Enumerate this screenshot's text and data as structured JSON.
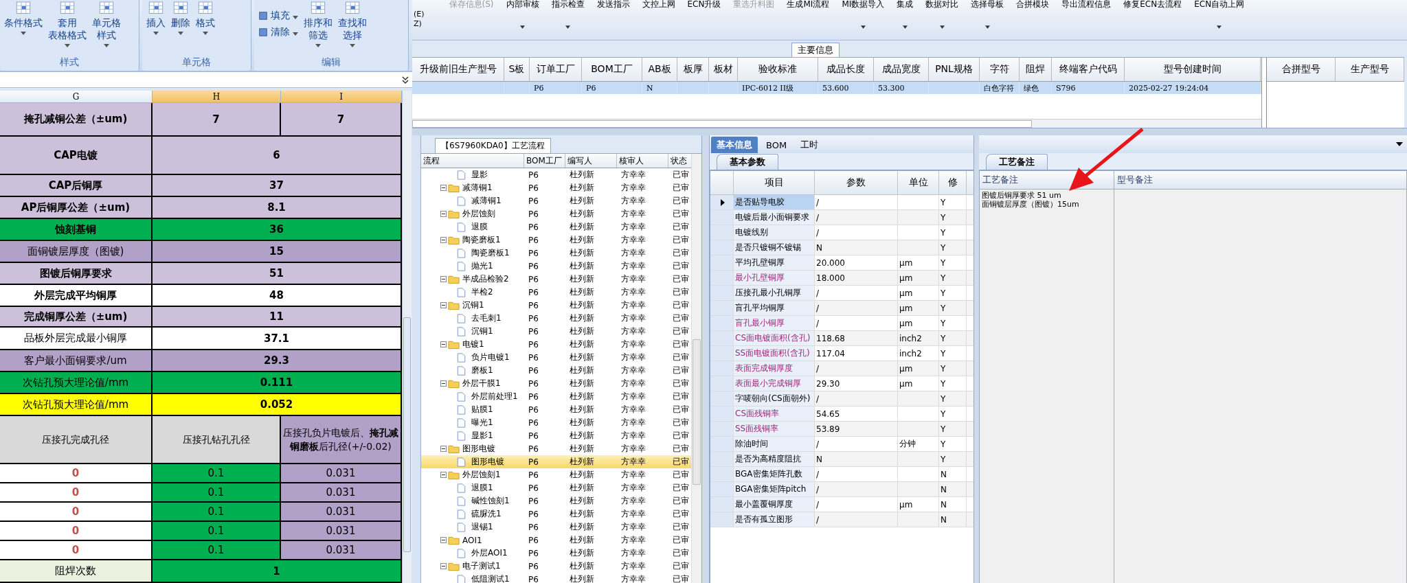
{
  "sheet": {
    "ribbon": [
      {
        "label": "样式",
        "buttons": [
          {
            "lines": [
              "条件格式"
            ],
            "dropdown": true
          },
          {
            "lines": [
              "套用",
              "表格格式"
            ],
            "dropdown": true
          },
          {
            "lines": [
              "单元格",
              "样式"
            ],
            "dropdown": true
          }
        ]
      },
      {
        "label": "单元格",
        "buttons": [
          {
            "lines": [
              "插入"
            ],
            "dropdown": true
          },
          {
            "lines": [
              "删除"
            ],
            "dropdown": true
          },
          {
            "lines": [
              "格式"
            ],
            "dropdown": true
          }
        ]
      },
      {
        "label": "编辑",
        "buttons": [
          {
            "lines": [
              "排序和",
              "筛选"
            ],
            "dropdown": true
          },
          {
            "lines": [
              "查找和",
              "选择"
            ],
            "dropdown": true
          }
        ],
        "small": [
          {
            "label": "填充",
            "dropdown": true
          },
          {
            "label": "清除",
            "dropdown": true
          }
        ]
      }
    ],
    "columns": [
      {
        "label": "G",
        "selected": false
      },
      {
        "label": "H",
        "selected": true
      },
      {
        "label": "I",
        "selected": true
      }
    ],
    "rows": [
      {
        "kind": "split",
        "cells": [
          {
            "text": "掩孔减铜公差（±um)",
            "color": "#ccc0da",
            "bold": true
          },
          {
            "text": "7",
            "color": "#ccc0da",
            "bold": true
          },
          {
            "text": "7",
            "color": "#ccc0da",
            "bold": true
          }
        ]
      },
      {
        "kind": "pair",
        "cells": [
          {
            "text": "CAP电镀",
            "color": "#ccc0da",
            "bold": true
          },
          {
            "text": "6",
            "color": "#ccc0da",
            "bold": true
          }
        ]
      },
      {
        "kind": "pair",
        "cells": [
          {
            "text": "CAP后铜厚",
            "color": "#ccc0da",
            "bold": true
          },
          {
            "text": "37",
            "color": "#ccc0da",
            "bold": true
          }
        ]
      },
      {
        "kind": "pair",
        "cells": [
          {
            "text": "AP后铜厚公差（±um)",
            "color": "#ccc0da",
            "bold": true
          },
          {
            "text": "8.1",
            "color": "#ccc0da",
            "bold": true
          }
        ]
      },
      {
        "kind": "pair",
        "cells": [
          {
            "text": "蚀刻基铜",
            "color": "#00b050",
            "bold": true
          },
          {
            "text": "36",
            "color": "#00b050",
            "bold": true
          }
        ]
      },
      {
        "kind": "pair",
        "cells": [
          {
            "text": "面铜镀层厚度（图镀)",
            "color": "#b1a0c7",
            "bold": false
          },
          {
            "text": "15",
            "color": "#b1a0c7",
            "bold": true
          }
        ]
      },
      {
        "kind": "pair",
        "cells": [
          {
            "text": "图镀后铜厚要求",
            "color": "#ccc0da",
            "bold": true
          },
          {
            "text": "51",
            "color": "#ccc0da",
            "bold": true
          }
        ]
      },
      {
        "kind": "pair",
        "cells": [
          {
            "text": "外层完成平均铜厚",
            "color": "#ffffff",
            "bold": true
          },
          {
            "text": "48",
            "color": "#ffffff",
            "bold": true
          }
        ]
      },
      {
        "kind": "pair",
        "cells": [
          {
            "text": "完成铜厚公差（±um)",
            "color": "#ccc0da",
            "bold": true
          },
          {
            "text": "11",
            "color": "#ccc0da",
            "bold": true
          }
        ]
      },
      {
        "kind": "pair",
        "cells": [
          {
            "text": "品板外层完成最小铜厚",
            "color": "#ffffff",
            "bold": false
          },
          {
            "text": "37.1",
            "color": "#ffffff",
            "bold": true
          }
        ]
      },
      {
        "kind": "pair",
        "cells": [
          {
            "text": "客户最小面铜要求/um",
            "color": "#b1a0c7",
            "bold": false
          },
          {
            "text": "29.3",
            "color": "#b1a0c7",
            "bold": true
          }
        ]
      },
      {
        "kind": "pair",
        "cells": [
          {
            "text": "次钻孔预大理论值/mm",
            "color": "#00b050",
            "bold": false
          },
          {
            "text": "0.111",
            "color": "#00b050",
            "bold": true
          }
        ]
      },
      {
        "kind": "pair",
        "cells": [
          {
            "text": "次钻孔预大理论值/mm",
            "color": "#ffff00",
            "bold": false
          },
          {
            "text": "0.052",
            "color": "#ffff00",
            "bold": true
          }
        ]
      },
      {
        "kind": "triple",
        "cells": [
          {
            "text": "压接孔完成孔径",
            "color": "#d9d9d9",
            "bold": false
          },
          {
            "text": "压接孔钻孔孔径",
            "color": "#d9d9d9",
            "bold": false
          },
          {
            "text": "压接孔负片电镀后、**掩孔减铜磨板**后孔径(+/-0.02)",
            "color": "#b1a0c7",
            "bold": false
          }
        ]
      },
      {
        "kind": "triple",
        "cells": [
          {
            "text": "0",
            "color": "#ffffff",
            "bold": true,
            "warning": true
          },
          {
            "text": "0.1",
            "color": "#00b050",
            "bold": false
          },
          {
            "text": "0.031",
            "color": "#b1a0c7",
            "bold": false
          }
        ]
      },
      {
        "kind": "triple",
        "cells": [
          {
            "text": "0",
            "color": "#ffffff",
            "bold": true,
            "warning": true
          },
          {
            "text": "0.1",
            "color": "#00b050",
            "bold": false
          },
          {
            "text": "0.031",
            "color": "#b1a0c7",
            "bold": false
          }
        ]
      },
      {
        "kind": "triple",
        "cells": [
          {
            "text": "0",
            "color": "#ffffff",
            "bold": true,
            "warning": true
          },
          {
            "text": "0.1",
            "color": "#00b050",
            "bold": false
          },
          {
            "text": "0.031",
            "color": "#b1a0c7",
            "bold": false
          }
        ]
      },
      {
        "kind": "triple",
        "cells": [
          {
            "text": "0",
            "color": "#ffffff",
            "bold": true,
            "warning": true
          },
          {
            "text": "0.1",
            "color": "#00b050",
            "bold": false
          },
          {
            "text": "0.031",
            "color": "#b1a0c7",
            "bold": false
          }
        ]
      },
      {
        "kind": "triple",
        "cells": [
          {
            "text": "0",
            "color": "#ffffff",
            "bold": true,
            "warning": true
          },
          {
            "text": "0.1",
            "color": "#00b050",
            "bold": false
          },
          {
            "text": "0.031",
            "color": "#b1a0c7",
            "bold": false
          }
        ]
      },
      {
        "kind": "pair",
        "cells": [
          {
            "text": "阻焊次数",
            "color": "#ebf1de",
            "bold": false
          },
          {
            "text": "1",
            "color": "#00b050",
            "bold": true
          }
        ]
      }
    ]
  },
  "toolbar": {
    "menu_fragments": [
      "(E)",
      "Z)"
    ],
    "items": [
      {
        "label": "保存信息(S)",
        "disabled": true,
        "dropdown": false
      },
      {
        "label": "内部审核",
        "disabled": false,
        "dropdown": true
      },
      {
        "label": "指示检查",
        "disabled": false,
        "dropdown": true
      },
      {
        "label": "发送指示",
        "disabled": false,
        "dropdown": false
      },
      {
        "label": "文控上网",
        "disabled": false,
        "dropdown": false
      },
      {
        "label": "ECN升级",
        "disabled": false,
        "dropdown": false
      },
      {
        "label": "重选升料图",
        "disabled": true,
        "dropdown": false
      },
      {
        "label": "生成MI流程",
        "disabled": false,
        "dropdown": false
      },
      {
        "label": "MI数据导入",
        "disabled": false,
        "dropdown": true
      },
      {
        "label": "集成",
        "disabled": false,
        "dropdown": true
      },
      {
        "label": "数据对比",
        "disabled": false,
        "dropdown": true
      },
      {
        "label": "选择母板",
        "disabled": false,
        "dropdown": true
      },
      {
        "label": "合拼模块",
        "disabled": false,
        "dropdown": false
      },
      {
        "label": "导出流程信息",
        "disabled": false,
        "dropdown": false
      },
      {
        "label": "修复ECN去流程",
        "disabled": false,
        "dropdown": false
      },
      {
        "label": "ECN自动上网",
        "disabled": false,
        "dropdown": true
      }
    ]
  },
  "main_info": {
    "title": "主要信息",
    "columns": [
      "升级前旧生产型号",
      "S板",
      "订单工厂",
      "BOM工厂",
      "AB板",
      "板厚",
      "板材",
      "验收标准",
      "成品长度",
      "成品宽度",
      "PNL规格",
      "字符",
      "阻焊",
      "终端客户代码",
      "型号创建时间"
    ],
    "rows": [
      {
        "selected": true,
        "cells": [
          "",
          "",
          "P6",
          "P6",
          "N",
          "",
          "",
          "IPC-6012 II级",
          "53.600",
          "53.300",
          "",
          "白色字符",
          "绿色",
          "S796",
          "2025-02-27 19:24:04"
        ]
      }
    ],
    "side_columns": [
      "合拼型号",
      "生产型号"
    ]
  },
  "process": {
    "title": "【6S7960KDA0】工艺流程",
    "columns": [
      "流程",
      "BOM工厂",
      "编写人",
      "核审人",
      "状态"
    ],
    "nodes": [
      {
        "kind": "leaf",
        "label": "显影",
        "bom": "P6",
        "writer": "杜列新",
        "reviewer": "方幸幸",
        "status": "已审",
        "selected": false
      },
      {
        "kind": "folder",
        "label": "减薄铜1",
        "bom": "P6",
        "writer": "杜列新",
        "reviewer": "方幸幸",
        "status": "已审",
        "selected": false,
        "expanded": true,
        "children": [
          {
            "kind": "leaf",
            "label": "减薄铜1",
            "bom": "P6",
            "writer": "杜列新",
            "reviewer": "方幸幸",
            "status": "已审",
            "selected": false
          }
        ]
      },
      {
        "kind": "folder",
        "label": "外层蚀刻",
        "bom": "P6",
        "writer": "杜列新",
        "reviewer": "方幸幸",
        "status": "已审",
        "selected": false,
        "expanded": true,
        "children": [
          {
            "kind": "leaf",
            "label": "退膜",
            "bom": "P6",
            "writer": "杜列新",
            "reviewer": "方幸幸",
            "status": "已审",
            "selected": false
          }
        ]
      },
      {
        "kind": "folder",
        "label": "陶瓷磨板1",
        "bom": "P6",
        "writer": "杜列新",
        "reviewer": "方幸幸",
        "status": "已审",
        "selected": false,
        "expanded": true,
        "children": [
          {
            "kind": "leaf",
            "label": "陶瓷磨板1",
            "bom": "P6",
            "writer": "杜列新",
            "reviewer": "方幸幸",
            "status": "已审",
            "selected": false
          },
          {
            "kind": "leaf",
            "label": "抛光1",
            "bom": "P6",
            "writer": "杜列新",
            "reviewer": "方幸幸",
            "status": "已审",
            "selected": false
          }
        ]
      },
      {
        "kind": "folder",
        "label": "半成品检验2",
        "bom": "P6",
        "writer": "杜列新",
        "reviewer": "方幸幸",
        "status": "已审",
        "selected": false,
        "expanded": true,
        "children": [
          {
            "kind": "leaf",
            "label": "半检2",
            "bom": "P6",
            "writer": "杜列新",
            "reviewer": "方幸幸",
            "status": "已审",
            "selected": false
          }
        ]
      },
      {
        "kind": "folder",
        "label": "沉铜1",
        "bom": "P6",
        "writer": "杜列新",
        "reviewer": "方幸幸",
        "status": "已审",
        "selected": false,
        "expanded": true,
        "children": [
          {
            "kind": "leaf",
            "label": "去毛刺1",
            "bom": "P6",
            "writer": "杜列新",
            "reviewer": "方幸幸",
            "status": "已审",
            "selected": false
          },
          {
            "kind": "leaf",
            "label": "沉铜1",
            "bom": "P6",
            "writer": "杜列新",
            "reviewer": "方幸幸",
            "status": "已审",
            "selected": false
          }
        ]
      },
      {
        "kind": "folder",
        "label": "电镀1",
        "bom": "P6",
        "writer": "杜列新",
        "reviewer": "方幸幸",
        "status": "已审",
        "selected": false,
        "expanded": true,
        "children": [
          {
            "kind": "leaf",
            "label": "负片电镀1",
            "bom": "P6",
            "writer": "杜列新",
            "reviewer": "方幸幸",
            "status": "已审",
            "selected": false
          },
          {
            "kind": "leaf",
            "label": "磨板1",
            "bom": "P6",
            "writer": "杜列新",
            "reviewer": "方幸幸",
            "status": "已审",
            "selected": false
          }
        ]
      },
      {
        "kind": "folder",
        "label": "外层干膜1",
        "bom": "P6",
        "writer": "杜列新",
        "reviewer": "方幸幸",
        "status": "已审",
        "selected": false,
        "expanded": true,
        "children": [
          {
            "kind": "leaf",
            "label": "外层前处理1",
            "bom": "P6",
            "writer": "杜列新",
            "reviewer": "方幸幸",
            "status": "已审",
            "selected": false
          },
          {
            "kind": "leaf",
            "label": "贴膜1",
            "bom": "P6",
            "writer": "杜列新",
            "reviewer": "方幸幸",
            "status": "已审",
            "selected": false
          },
          {
            "kind": "leaf",
            "label": "曝光1",
            "bom": "P6",
            "writer": "杜列新",
            "reviewer": "方幸幸",
            "status": "已审",
            "selected": false
          },
          {
            "kind": "leaf",
            "label": "显影1",
            "bom": "P6",
            "writer": "杜列新",
            "reviewer": "方幸幸",
            "status": "已审",
            "selected": false
          }
        ]
      },
      {
        "kind": "folder",
        "label": "图形电镀",
        "bom": "P6",
        "writer": "杜列新",
        "reviewer": "方幸幸",
        "status": "已审",
        "selected": false,
        "expanded": true,
        "children": [
          {
            "kind": "leaf",
            "label": "图形电镀",
            "bom": "P6",
            "writer": "杜列新",
            "reviewer": "方幸幸",
            "status": "已审",
            "selected": true
          }
        ]
      },
      {
        "kind": "folder",
        "label": "外层蚀刻1",
        "bom": "P6",
        "writer": "杜列新",
        "reviewer": "方幸幸",
        "status": "已审",
        "selected": false,
        "expanded": true,
        "children": [
          {
            "kind": "leaf",
            "label": "退膜1",
            "bom": "P6",
            "writer": "杜列新",
            "reviewer": "方幸幸",
            "status": "已审",
            "selected": false
          },
          {
            "kind": "leaf",
            "label": "碱性蚀刻1",
            "bom": "P6",
            "writer": "杜列新",
            "reviewer": "方幸幸",
            "status": "已审",
            "selected": false
          },
          {
            "kind": "leaf",
            "label": "硫脲洗1",
            "bom": "P6",
            "writer": "杜列新",
            "reviewer": "方幸幸",
            "status": "已审",
            "selected": false
          },
          {
            "kind": "leaf",
            "label": "退锡1",
            "bom": "P6",
            "writer": "杜列新",
            "reviewer": "方幸幸",
            "status": "已审",
            "selected": false
          }
        ]
      },
      {
        "kind": "folder",
        "label": "AOI1",
        "bom": "P6",
        "writer": "杜列新",
        "reviewer": "方幸幸",
        "status": "已审",
        "selected": false,
        "expanded": true,
        "children": [
          {
            "kind": "leaf",
            "label": "外层AOI1",
            "bom": "P6",
            "writer": "杜列新",
            "reviewer": "方幸幸",
            "status": "已审",
            "selected": false
          }
        ]
      },
      {
        "kind": "folder",
        "label": "电子测试1",
        "bom": "P6",
        "writer": "杜列新",
        "reviewer": "方幸幸",
        "status": "已审",
        "selected": false,
        "expanded": true,
        "children": [
          {
            "kind": "leaf",
            "label": "低阻测试1",
            "bom": "P6",
            "writer": "杜列新",
            "reviewer": "方幸幸",
            "status": "已审",
            "selected": false
          }
        ]
      }
    ]
  },
  "basic": {
    "tabs": [
      {
        "label": "基本信息",
        "selected": true
      },
      {
        "label": "BOM",
        "selected": false
      },
      {
        "label": "工时",
        "selected": false
      }
    ],
    "subtab": "基本参数",
    "columns": [
      "项目",
      "参数",
      "单位",
      "修"
    ],
    "rows": [
      {
        "item": "是否贴导电胶",
        "param": "/",
        "unit": "",
        "modified": "Y",
        "flagged": false,
        "current": true
      },
      {
        "item": "电镀后最小面铜要求",
        "param": "/",
        "unit": "",
        "modified": "Y",
        "flagged": false,
        "current": false
      },
      {
        "item": "电镀线别",
        "param": "/",
        "unit": "",
        "modified": "Y",
        "flagged": false,
        "current": false
      },
      {
        "item": "是否只镀铜不镀锡",
        "param": "N",
        "unit": "",
        "modified": "Y",
        "flagged": false,
        "current": false
      },
      {
        "item": "平均孔壁铜厚",
        "param": "20.000",
        "unit": "μm",
        "modified": "Y",
        "flagged": false,
        "current": false
      },
      {
        "item": "最小孔壁铜厚",
        "param": "18.000",
        "unit": "μm",
        "modified": "Y",
        "flagged": true,
        "current": false
      },
      {
        "item": "压接孔最小孔铜厚",
        "param": "/",
        "unit": "μm",
        "modified": "Y",
        "flagged": false,
        "current": false
      },
      {
        "item": "盲孔平均铜厚",
        "param": "/",
        "unit": "μm",
        "modified": "Y",
        "flagged": false,
        "current": false
      },
      {
        "item": "盲孔最小铜厚",
        "param": "/",
        "unit": "μm",
        "modified": "Y",
        "flagged": true,
        "current": false
      },
      {
        "item": "CS面电镀面积(含孔)",
        "param": "118.68",
        "unit": "inch2",
        "modified": "Y",
        "flagged": true,
        "current": false
      },
      {
        "item": "SS面电镀面积(含孔)",
        "param": "117.04",
        "unit": "inch2",
        "modified": "Y",
        "flagged": true,
        "current": false
      },
      {
        "item": "表面完成铜厚度",
        "param": "/",
        "unit": "μm",
        "modified": "Y",
        "flagged": true,
        "current": false
      },
      {
        "item": "表面最小完成铜厚",
        "param": "29.30",
        "unit": "μm",
        "modified": "Y",
        "flagged": true,
        "current": false
      },
      {
        "item": "字唛朝向(CS面朝外)",
        "param": "/",
        "unit": "",
        "modified": "Y",
        "flagged": false,
        "current": false
      },
      {
        "item": "CS面残铜率",
        "param": "54.65",
        "unit": "",
        "modified": "Y",
        "flagged": true,
        "current": false
      },
      {
        "item": "SS面残铜率",
        "param": "53.89",
        "unit": "",
        "modified": "Y",
        "flagged": true,
        "current": false
      },
      {
        "item": "除油时间",
        "param": "/",
        "unit": "分钟",
        "modified": "Y",
        "flagged": false,
        "current": false
      },
      {
        "item": "是否为高精度阻抗",
        "param": "N",
        "unit": "",
        "modified": "Y",
        "flagged": false,
        "current": false
      },
      {
        "item": "BGA密集矩阵孔数",
        "param": "/",
        "unit": "",
        "modified": "N",
        "flagged": false,
        "current": false
      },
      {
        "item": "BGA密集矩阵pitch",
        "param": "/",
        "unit": "",
        "modified": "N",
        "flagged": false,
        "current": false
      },
      {
        "item": "最小盖覆铜厚度",
        "param": "/",
        "unit": "μm",
        "modified": "N",
        "flagged": false,
        "current": false
      },
      {
        "item": "是否有孤立图形",
        "param": "/",
        "unit": "",
        "modified": "N",
        "flagged": false,
        "current": false
      }
    ]
  },
  "notes": {
    "subtab": "工艺备注",
    "columns": [
      "工艺备注",
      "型号备注"
    ],
    "process_note": [
      "图镀后铜厚要求 51 um",
      "面铜镀层厚度（图镀）15um"
    ]
  }
}
